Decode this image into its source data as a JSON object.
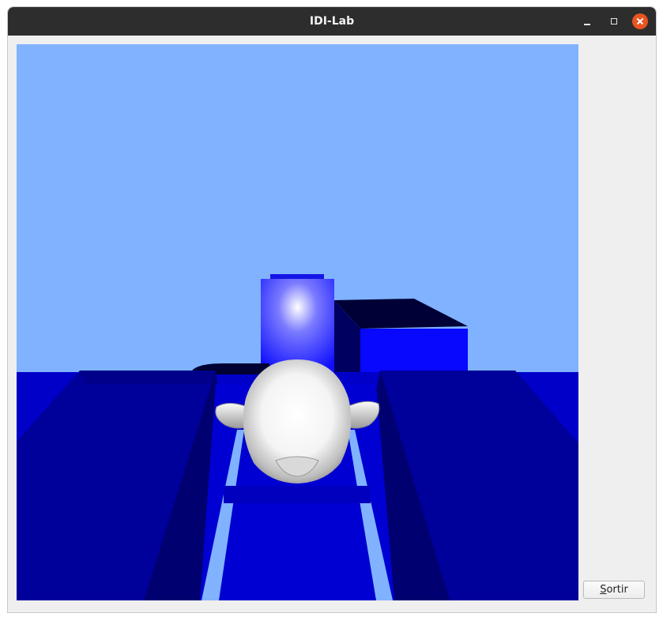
{
  "window": {
    "title": "IDI-Lab",
    "controls": [
      "minimize-icon",
      "maximize-icon",
      "close-icon"
    ]
  },
  "scene": {
    "sky_color": "#80b2ff",
    "floor_color": "#0000c8",
    "wall_color": "#000090",
    "path_color": "#80b2ff",
    "pillar_color": "#2a2aff",
    "model_color": "#f2f2f2"
  },
  "exit_button": {
    "mnemonic": "S",
    "rest": "ortir"
  }
}
